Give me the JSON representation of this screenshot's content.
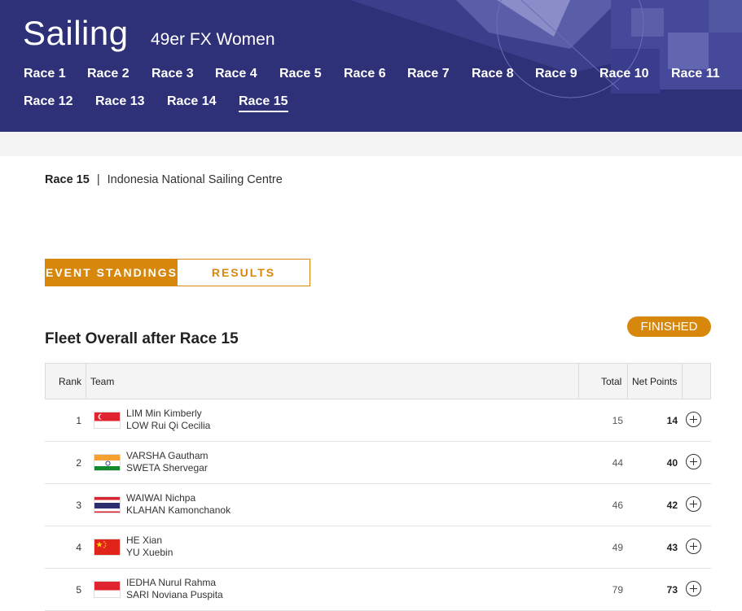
{
  "header": {
    "sport": "Sailing",
    "event": "49er FX Women",
    "races": [
      "Race 1",
      "Race 2",
      "Race 3",
      "Race 4",
      "Race 5",
      "Race 6",
      "Race 7",
      "Race 8",
      "Race 9",
      "Race 10",
      "Race 11",
      "Race 12",
      "Race 13",
      "Race 14",
      "Race 15"
    ],
    "active_race": "Race 15",
    "bg_color": "#2f3178"
  },
  "breadcrumb": {
    "race": "Race 15",
    "separator": "|",
    "venue": "Indonesia National Sailing Centre"
  },
  "toggle": {
    "standings": "EVENT STANDINGS",
    "results": "RESULTS",
    "accent": "#d7870c"
  },
  "status_badge": "FINISHED",
  "section_title": "Fleet Overall after Race 15",
  "table": {
    "columns": {
      "rank": "Rank",
      "team": "Team",
      "total": "Total",
      "net": "Net Points"
    },
    "rows": [
      {
        "rank": "1",
        "flag": "singapore-flag",
        "sailor1": "LIM Min Kimberly",
        "sailor2": "LOW Rui Qi Cecilia",
        "total": "15",
        "net": "14"
      },
      {
        "rank": "2",
        "flag": "india-flag",
        "sailor1": "VARSHA Gautham",
        "sailor2": "SWETA Shervegar",
        "total": "44",
        "net": "40"
      },
      {
        "rank": "3",
        "flag": "thailand-flag",
        "sailor1": "WAIWAI Nichpa",
        "sailor2": "KLAHAN Kamonchanok",
        "total": "46",
        "net": "42"
      },
      {
        "rank": "4",
        "flag": "china-flag",
        "sailor1": "HE Xian",
        "sailor2": "YU Xuebin",
        "total": "49",
        "net": "43"
      },
      {
        "rank": "5",
        "flag": "indonesia-flag",
        "sailor1": "IEDHA Nurul Rahma",
        "sailor2": "SARI Noviana Puspita",
        "total": "79",
        "net": "73"
      }
    ]
  }
}
